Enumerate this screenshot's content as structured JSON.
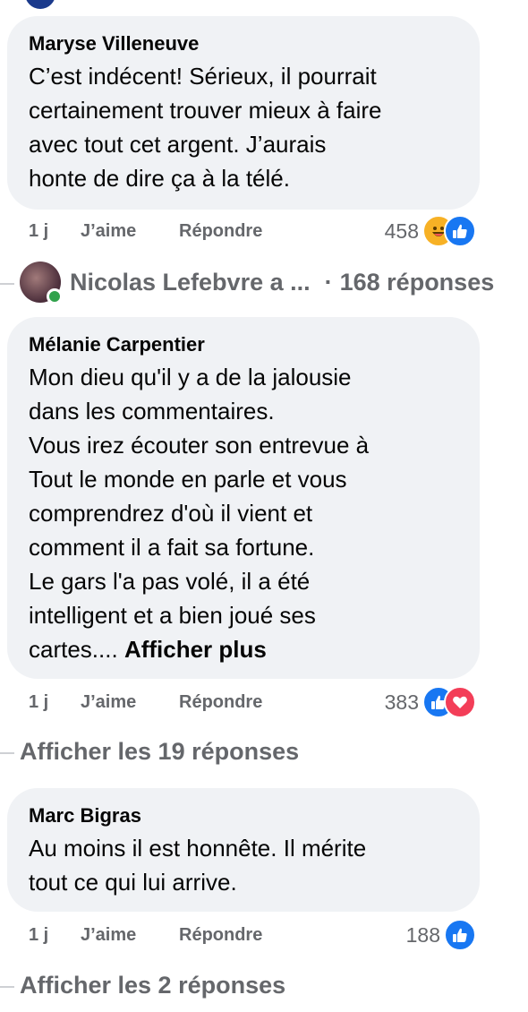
{
  "comments": [
    {
      "author": "Maryse Villeneuve",
      "lines": [
        "C’est indécent! Sérieux, il pourrait",
        "certainement trouver mieux à faire",
        "avec tout cet argent. J’aurais",
        "honte de dire ça à la télé."
      ],
      "time": "1 j",
      "like_label": "J’aime",
      "reply_label": "Répondre",
      "reaction_count": "458",
      "reactions": [
        "haha-icon",
        "like-icon"
      ]
    },
    {
      "author": "Mélanie Carpentier",
      "lines": [
        "Mon dieu qu'il y a de la jalousie",
        "dans les commentaires.",
        "Vous irez écouter son entrevue à",
        "Tout le monde en parle et vous",
        "comprendrez d'où il vient et",
        "comment il a fait sa fortune.",
        "Le gars l'a pas volé, il a été",
        "intelligent et a bien joué ses",
        "cartes...."
      ],
      "more_label": "Afficher plus",
      "time": "1 j",
      "like_label": "J’aime",
      "reply_label": "Répondre",
      "reaction_count": "383",
      "reactions": [
        "like-icon",
        "love-icon"
      ],
      "show_replies": "Afficher les 19 réponses"
    },
    {
      "author": "Marc Bigras",
      "lines": [
        "Au moins il est honnête. Il mérite",
        "tout ce qui lui arrive."
      ],
      "time": "1 j",
      "like_label": "J’aime",
      "reply_label": "Répondre",
      "reaction_count": "188",
      "reactions": [
        "like-icon"
      ],
      "show_replies": "Afficher les 2 réponses"
    }
  ],
  "reply_preview": {
    "author": "Nicolas Lefebvre a ...",
    "separator": "·",
    "count": "168 réponses"
  },
  "colors": {
    "bubble": "#f0f2f5",
    "meta": "#65676b",
    "like": "#1877f2",
    "love": "#f33e58",
    "haha": "#f7b125",
    "online": "#31a24c"
  }
}
